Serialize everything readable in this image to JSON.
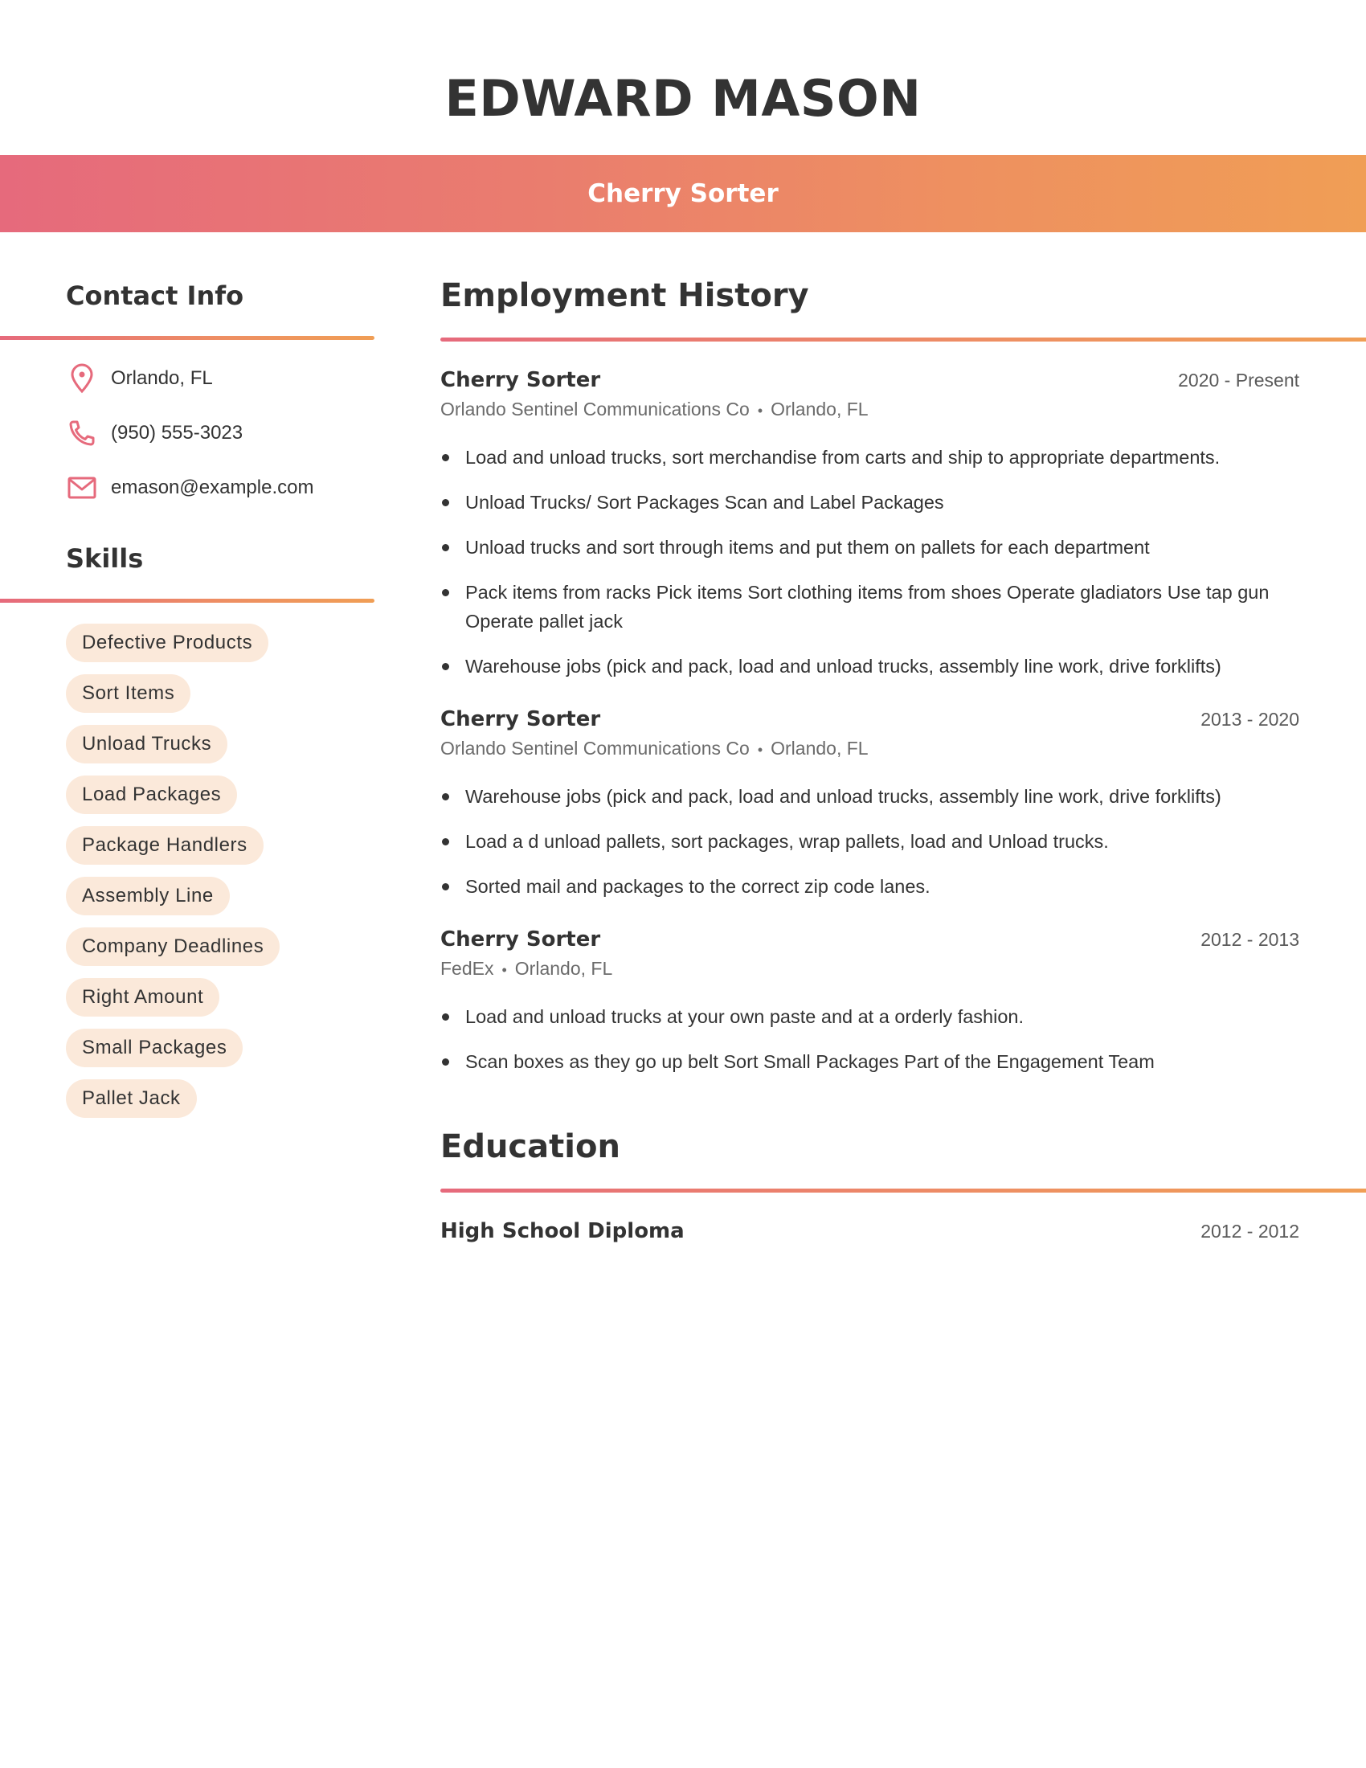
{
  "header": {
    "name": "EDWARD MASON",
    "job_title": "Cherry Sorter"
  },
  "colors": {
    "gradient_start": "#e66a7c",
    "gradient_end": "#f09e55",
    "pill_bg": "#fbe9da",
    "text": "#333333"
  },
  "contact": {
    "heading": "Contact Info",
    "items": [
      {
        "icon": "location-pin-icon",
        "text": "Orlando, FL"
      },
      {
        "icon": "phone-icon",
        "text": "(950) 555-3023"
      },
      {
        "icon": "email-icon",
        "text": "emason@example.com"
      }
    ]
  },
  "skills": {
    "heading": "Skills",
    "items": [
      "Defective Products",
      "Sort Items",
      "Unload Trucks",
      "Load Packages",
      "Package Handlers",
      "Assembly Line",
      "Company Deadlines",
      "Right Amount",
      "Small Packages",
      "Pallet Jack"
    ]
  },
  "employment": {
    "heading": "Employment History",
    "jobs": [
      {
        "title": "Cherry Sorter",
        "dates": "2020 - Present",
        "company": "Orlando Sentinel Communications Co",
        "location": "Orlando, FL",
        "bullets": [
          "Load and unload trucks, sort merchandise from carts and ship to appropriate departments.",
          "Unload Trucks/ Sort Packages Scan and Label Packages",
          "Unload trucks and sort through items and put them on pallets for each department",
          "Pack items from racks Pick items Sort clothing items from shoes Operate gladiators Use tap gun Operate pallet jack",
          "Warehouse jobs (pick and pack, load and unload trucks, assembly line work, drive forklifts)"
        ]
      },
      {
        "title": "Cherry Sorter",
        "dates": "2013 - 2020",
        "company": "Orlando Sentinel Communications Co",
        "location": "Orlando, FL",
        "bullets": [
          "Warehouse jobs (pick and pack, load and unload trucks, assembly line work, drive forklifts)",
          "Load a d unload pallets, sort packages, wrap pallets, load and Unload trucks.",
          "Sorted mail and packages to the correct zip code lanes."
        ]
      },
      {
        "title": "Cherry Sorter",
        "dates": "2012 - 2013",
        "company": "FedEx",
        "location": "Orlando, FL",
        "bullets": [
          "Load and unload trucks at your own paste and at a orderly fashion.",
          "Scan boxes as they go up belt Sort Small Packages Part of the Engagement Team"
        ]
      }
    ]
  },
  "education": {
    "heading": "Education",
    "items": [
      {
        "degree": "High School Diploma",
        "dates": "2012 - 2012"
      }
    ]
  }
}
